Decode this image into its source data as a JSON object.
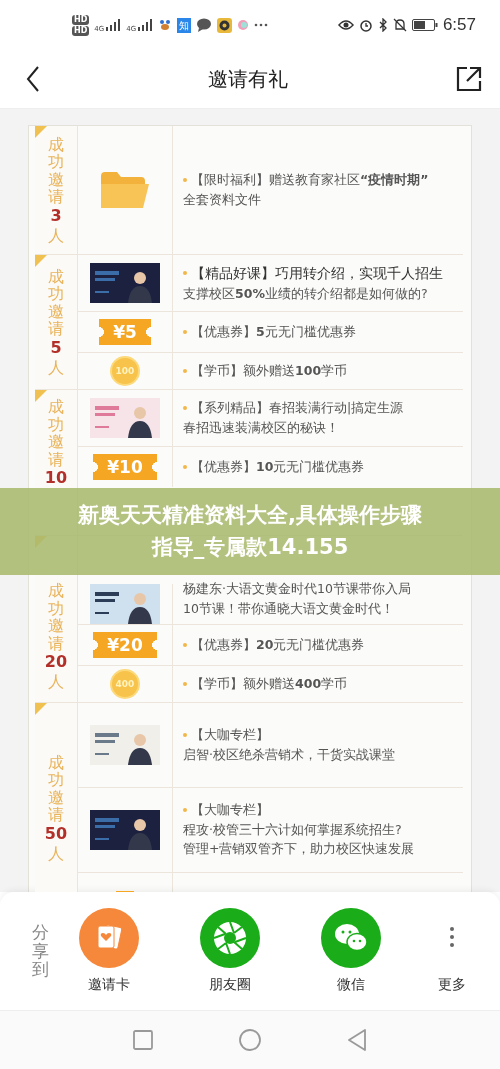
{
  "status_bar": {
    "sim_labels": [
      "HD",
      "HD"
    ],
    "network": [
      "4G",
      "4G"
    ],
    "app_badge": "知",
    "time": "6:57"
  },
  "header": {
    "title": "邀请有礼"
  },
  "sections": [
    {
      "label": {
        "words": "成功邀请",
        "count": "3",
        "unit": "人"
      },
      "rows": [
        {
          "kind": "folder",
          "lines": [
            "【限时福利】赠送教育家社区**“疫情时期”**",
            "全套资料文件"
          ]
        }
      ]
    },
    {
      "label": {
        "words": "成功邀请",
        "count": "5",
        "unit": "人"
      },
      "rows": [
        {
          "kind": "course",
          "lines": [
            "【精品好课】巧用转介绍，实现千人招生",
            "支撑校区**50%**业绩的转介绍都是如何做的?"
          ]
        },
        {
          "kind": "coupon",
          "badge": "¥5",
          "lines": [
            "【优惠券】**5**元无门槛优惠券"
          ]
        },
        {
          "kind": "coin",
          "badge": "100",
          "lines": [
            "【学币】额外赠送**100**学币"
          ]
        }
      ]
    },
    {
      "label": {
        "words": "成功邀请",
        "count": "10"
      },
      "rows": [
        {
          "kind": "course",
          "lines": [
            "【系列精品】春招装满行动|搞定生源",
            "春招迅速装满校区的秘诀！"
          ]
        },
        {
          "kind": "coupon",
          "badge": "¥10",
          "lines": [
            "【优惠券】**10**元无门槛优惠券"
          ]
        }
      ]
    },
    {
      "label": {
        "words": "成功邀请",
        "count": "20",
        "unit": "人"
      },
      "rows": [
        {
          "kind": "course",
          "bullet": false,
          "lines": [
            "杨建东·大语文黄金时代10节课带你入局",
            "10节课！带你通晓大语文黄金时代！"
          ]
        },
        {
          "kind": "coupon",
          "badge": "¥20",
          "lines": [
            "【优惠券】**20**元无门槛优惠券"
          ]
        },
        {
          "kind": "coin",
          "badge": "400",
          "lines": [
            "【学币】额外赠送**400**学币"
          ]
        }
      ]
    },
    {
      "label": {
        "words": "成功邀请",
        "count": "50",
        "unit": "人"
      },
      "rows": [
        {
          "kind": "course",
          "lines": [
            "【大咖专栏】",
            "启智·校区绝杀营销术，干货实战课堂"
          ]
        },
        {
          "kind": "course",
          "lines": [
            "【大咖专栏】",
            "程攻·校管三十六计如何掌握系统招生?",
            "管理+营销双管齐下，助力校区快速发展"
          ]
        },
        {
          "kind": "coupon",
          "lines": []
        }
      ]
    }
  ],
  "banner": {
    "lines": [
      "新奥天天精准资料大全,具体操作步骤",
      "指导_专属款14.155"
    ]
  },
  "share": {
    "title": "分享到",
    "items": [
      {
        "kind": "card",
        "label": "邀请卡",
        "color": "#f5883a"
      },
      {
        "kind": "moments",
        "label": "朋友圈",
        "color": "#1aad19"
      },
      {
        "kind": "wechat",
        "label": "微信",
        "color": "#1aad19"
      },
      {
        "kind": "more",
        "label": "更多"
      }
    ]
  }
}
